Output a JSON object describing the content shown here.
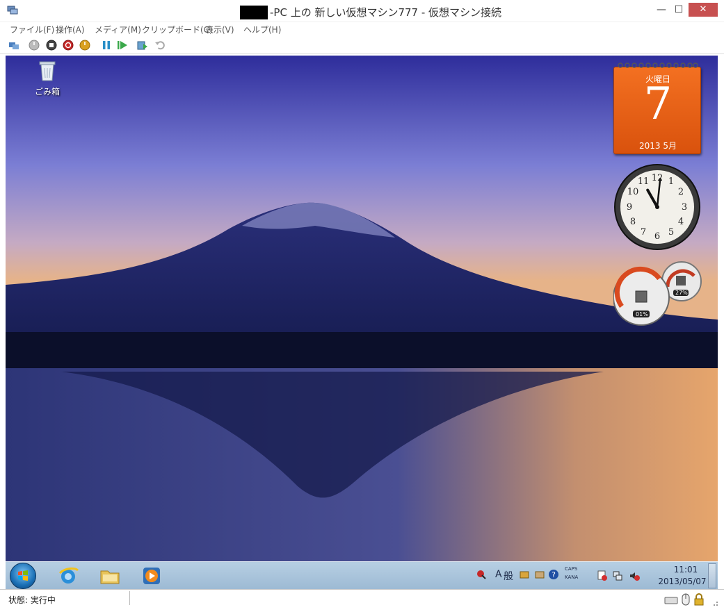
{
  "window": {
    "title": "-PC 上の 新しい仮想マシン777  - 仮想マシン接続",
    "minimize": "—",
    "maximize": "☐",
    "close": "✕"
  },
  "menu": [
    {
      "label": "ファイル(F)"
    },
    {
      "label": "操作(A)"
    },
    {
      "label": "メディア(M)"
    },
    {
      "label": "クリップボード(C)"
    },
    {
      "label": "表示(V)"
    },
    {
      "label": "ヘルプ(H)"
    }
  ],
  "toolbar": {
    "buttons": [
      "ctrl-alt-del-icon",
      "start-icon",
      "turn-off-icon",
      "shutdown-icon",
      "save-icon",
      "pause-icon",
      "resume-icon",
      "snapshot-icon",
      "revert-icon"
    ]
  },
  "desktop": {
    "recycle_bin_label": "ごみ箱",
    "calendar": {
      "day": "火曜日",
      "date": "7",
      "month": "2013 5月"
    },
    "clock": {
      "hour": 11,
      "minute": 1
    },
    "meter": {
      "cpu": "01%",
      "memory": "27%"
    }
  },
  "taskbar": {
    "ime_a": "A",
    "ime_mode": "般",
    "caps": "CAPS",
    "kana": "KANA",
    "time": "11:01",
    "date": "2013/05/07"
  },
  "status": {
    "text": "状態: 実行中"
  },
  "colors": {
    "calendar_orange": "#f37021",
    "close_button": "#c75050",
    "taskbar": "#b7cfe3"
  }
}
